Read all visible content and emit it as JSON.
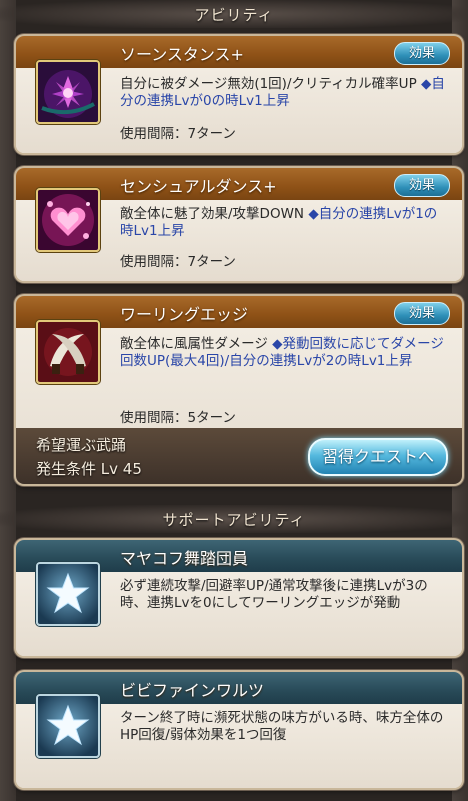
{
  "sections": {
    "abilities_title": "アビリティ",
    "support_title": "サポートアビリティ"
  },
  "abilities": [
    {
      "name": "ソーンスタンス+",
      "effect_label": "効果",
      "desc": "自分に被ダメージ無効(1回)/クリティカル確率UP",
      "cond": "◆自分の連携Lvが0の時Lv1上昇",
      "interval": "使用間隔：7ターン",
      "icon": "thorn-lotus-icon"
    },
    {
      "name": "センシュアルダンス+",
      "effect_label": "効果",
      "desc": "敵全体に魅了効果/攻撃DOWN",
      "cond": "◆自分の連携Lvが1の時Lv1上昇",
      "interval": "使用間隔：7ターン",
      "icon": "heart-charm-icon"
    },
    {
      "name": "ワーリングエッジ",
      "effect_label": "効果",
      "desc": "敵全体に風属性ダメージ",
      "cond": "◆発動回数に応じてダメージ回数UP(最大4回)/自分の連携Lvが2の時Lv1上昇",
      "interval": "使用間隔：5ターン",
      "icon": "crossed-blades-icon",
      "quest_title": "希望運ぶ武踊",
      "quest_condition": "発生条件 Lv 45",
      "quest_button": "習得クエストへ"
    }
  ],
  "support_abilities": [
    {
      "name": "マヤコフ舞踏団員",
      "desc": "必ず連続攻撃/回避率UP/通常攻撃後に連携Lvが3の時、連携Lvを0にしてワーリングエッジが発動",
      "icon": "star-icon"
    },
    {
      "name": "ビビファインワルツ",
      "desc": "ターン終了時に瀕死状態の味方がいる時、味方全体のHP回復/弱体効果を1つ回復",
      "icon": "star-icon"
    }
  ],
  "colors": {
    "ability_header": "#8e5116",
    "support_header": "#284a58",
    "condition_text": "#2a46a8",
    "effect_button": "#2e8fb8"
  }
}
